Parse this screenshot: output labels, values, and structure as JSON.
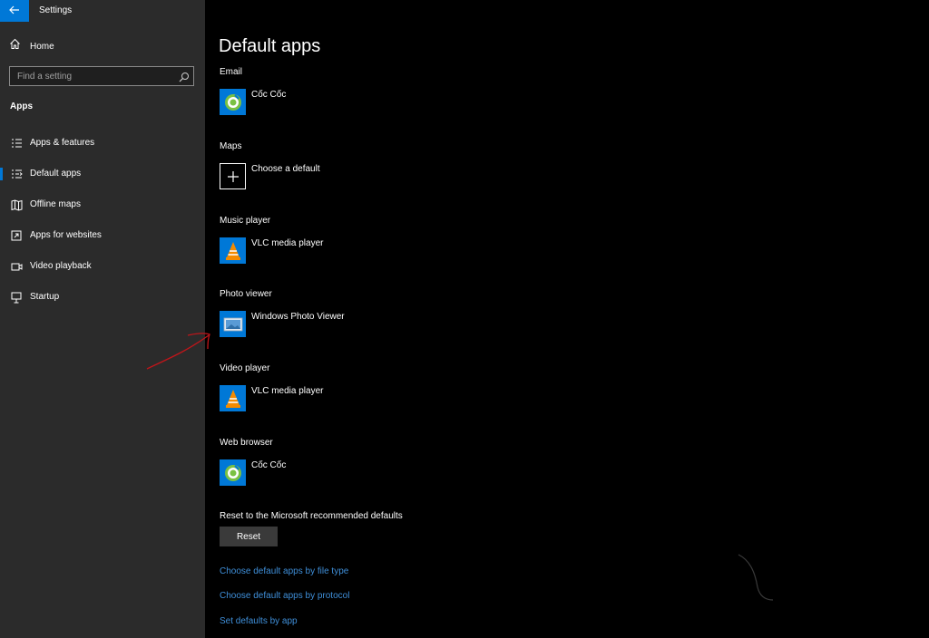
{
  "window": {
    "title": "Settings",
    "back_icon": "back-arrow-icon",
    "accent": "#0078d7"
  },
  "sidebar": {
    "home_label": "Home",
    "search_placeholder": "Find a setting",
    "section_heading": "Apps",
    "items": [
      {
        "label": "Apps & features",
        "icon": "list-icon",
        "active": false
      },
      {
        "label": "Default apps",
        "icon": "default-apps-icon",
        "active": true
      },
      {
        "label": "Offline maps",
        "icon": "map-icon",
        "active": false
      },
      {
        "label": "Apps for websites",
        "icon": "link-window-icon",
        "active": false
      },
      {
        "label": "Video playback",
        "icon": "video-icon",
        "active": false
      },
      {
        "label": "Startup",
        "icon": "startup-icon",
        "active": false
      }
    ]
  },
  "main": {
    "title": "Default apps",
    "sections": [
      {
        "label": "Email",
        "app": "Cốc Cốc",
        "icon": "coccoc-icon"
      },
      {
        "label": "Maps",
        "app": "Choose a default",
        "icon": "plus-icon"
      },
      {
        "label": "Music player",
        "app": "VLC media player",
        "icon": "vlc-icon"
      },
      {
        "label": "Photo viewer",
        "app": "Windows Photo Viewer",
        "icon": "photo-viewer-icon"
      },
      {
        "label": "Video player",
        "app": "VLC media player",
        "icon": "vlc-icon"
      },
      {
        "label": "Web browser",
        "app": "Cốc Cốc",
        "icon": "coccoc-icon"
      }
    ],
    "reset": {
      "label": "Reset to the Microsoft recommended defaults",
      "button": "Reset"
    },
    "links": [
      "Choose default apps by file type",
      "Choose default apps by protocol",
      "Set defaults by app"
    ],
    "link_color": "#3f8fd9"
  }
}
